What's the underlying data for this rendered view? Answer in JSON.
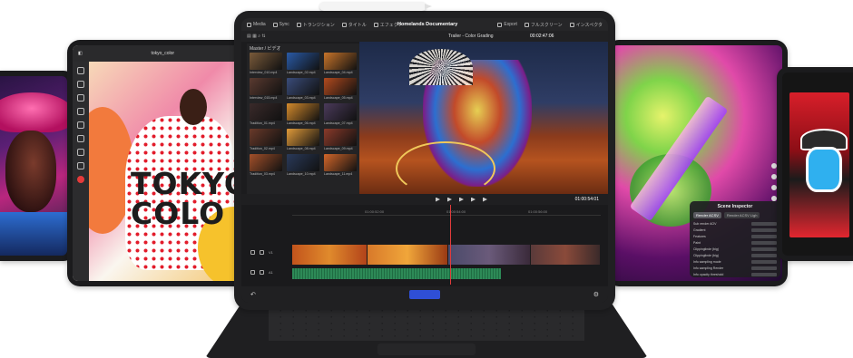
{
  "left_app": {
    "file_title": "tokyo_color",
    "artwork_text": "TOKYO\nCOLO"
  },
  "editor": {
    "project_title": "Homelands Documentary",
    "top_menu": [
      "Media",
      "Sync",
      "トランジション",
      "タイトル",
      "エフェクト"
    ],
    "top_right_menu": [
      "Export",
      "フルスクリーン",
      "インスペクタ"
    ],
    "timeline_name": "Trailer - Color Grading",
    "timecode_top": "00:02:47:06",
    "timecode_transport": "01:00:54:01",
    "bin_label": "Master / ビデオ",
    "ruler_labels": [
      "01:00:52:00",
      "01:00:54:00",
      "01:00:56:00"
    ],
    "clips": [
      {
        "name": "Interview_010.mp4",
        "color": "#7a5a3a"
      },
      {
        "name": "Landscape_02.mp4",
        "color": "#2a5aa6"
      },
      {
        "name": "Landscape_04.mp4",
        "color": "#c7742a"
      },
      {
        "name": "Interview_015.mp4",
        "color": "#5a3a30"
      },
      {
        "name": "Landscape_03.mp4",
        "color": "#3a4c7a"
      },
      {
        "name": "Landscape_05.mp4",
        "color": "#b24a1e"
      },
      {
        "name": "Tradition_01.mp4",
        "color": "#3a2a2a"
      },
      {
        "name": "Landscape_06.mp4",
        "color": "#d38a2c"
      },
      {
        "name": "Landscape_07.mp4",
        "color": "#4a3a5a"
      },
      {
        "name": "Tradition_02.mp4",
        "color": "#6a3a2a"
      },
      {
        "name": "Landscape_08.mp4",
        "color": "#e09a3a"
      },
      {
        "name": "Landscape_09.mp4",
        "color": "#8a3a2a"
      },
      {
        "name": "Tradition_03.mp4",
        "color": "#a3502a"
      },
      {
        "name": "Landscape_10.mp4",
        "color": "#2a3a5a"
      },
      {
        "name": "Landscape_11.mp4",
        "color": "#d2662a"
      }
    ],
    "track_labels": [
      "V1",
      "A1"
    ]
  },
  "inspector": {
    "title": "Scene Inspector",
    "tabs": [
      "Render ACSV",
      "Render ACSV Ligh"
    ],
    "rows": [
      "Sub render AOV",
      "Gradient",
      "Features",
      "Paint",
      "Clippinglinde (big)",
      "Clippinglinde (big)",
      "Info sampling mode",
      "Info sampling Render",
      "Info opacity threshold"
    ]
  },
  "colors": {
    "accent_blue": "#2f4fd6",
    "playhead_red": "#e03b3b",
    "audio_green": "#2d8a57"
  }
}
